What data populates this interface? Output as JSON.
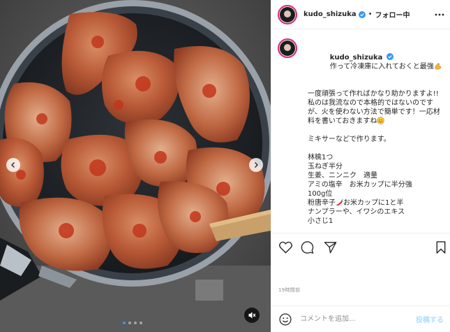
{
  "post": {
    "username": "kudo_shizuka",
    "follow_label": "フォロー中",
    "separator": "•",
    "caption_first": "作って冷凍庫に入れておくと最強",
    "caption_paragraphs": [
      "一度頑張って作ればかなり助かりますよ!!",
      "私のは我流なので本格的ではないのですが、火を使わない方法で簡単です！一応材料を書いておきますね"
    ],
    "caption_mixer": "ミキサーなどで作ります。",
    "ingredients": [
      "林檎1つ",
      "玉ねぎ半分",
      "生姜、ニンニク　適量",
      "アミの塩辛　お米カップに半分強",
      "100g位",
      "粉唐辛子",
      "お米カップに1と半",
      "ナンプラーや、イワシのエキス",
      "小さじ1"
    ],
    "time_ago": "19時間前",
    "comment_placeholder": "コメントを追加...",
    "post_label": "投稿する"
  },
  "media": {
    "carousel_count": 4,
    "active_index": 0
  },
  "colors": {
    "link_blue": "#3897f0",
    "post_disabled": "#b2dffc",
    "verified": "#3897f0",
    "divider": "#efefef",
    "meta_gray": "#8e8e8e"
  },
  "icons": [
    "chevron-left-icon",
    "chevron-right-icon",
    "mute-icon",
    "more-icon",
    "verified-icon",
    "heart-icon",
    "comment-icon",
    "share-icon",
    "bookmark-icon",
    "smiley-icon",
    "flexed-biceps-emoji",
    "smiling-face-emoji",
    "chili-pepper-emoji"
  ]
}
